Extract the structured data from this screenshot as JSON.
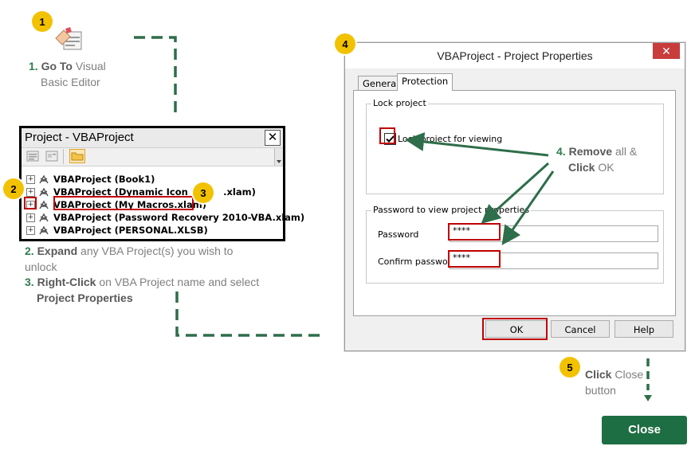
{
  "steps": {
    "s1": {
      "badge": "1",
      "num": "1.",
      "bold": "Go To",
      "rest1": "Visual",
      "rest2": "Basic Editor"
    },
    "s2": {
      "badge": "2",
      "num": "2.",
      "bold": "Expand",
      "rest": "any VBA Project(s) you wish to",
      "rest2": "unlock"
    },
    "s3": {
      "badge": "3",
      "num": "3.",
      "bold": "Right-Click",
      "rest": "on VBA Project name and select",
      "bold2": "Project Properties"
    },
    "s4": {
      "badge": "4",
      "num": "4.",
      "bold": "Remove",
      "rest": "all &",
      "bold2": "Click",
      "rest2": "OK"
    },
    "s5": {
      "badge": "5",
      "bold": "Click",
      "rest": "Close",
      "rest2": "button"
    }
  },
  "project_window": {
    "title": "Project - VBAProject",
    "close_glyph": "✕",
    "items": [
      {
        "label": "VBAProject (Book1)"
      },
      {
        "label": "VBAProject (Dynamic Icon Bro",
        "label_tail": ".xlam)"
      },
      {
        "label": "VBAProject (My Macros.xlam)"
      },
      {
        "label": "VBAProject (Password Recovery 2010-VBA.xlam)"
      },
      {
        "label": "VBAProject (PERSONAL.XLSB)"
      }
    ],
    "expand_glyph": "+"
  },
  "dialog": {
    "title": "VBAProject - Project Properties",
    "close_glyph": "✕",
    "tabs": [
      "General",
      "Protection"
    ],
    "lock_group_label": "Lock project",
    "lock_checkbox_label": "Lock project for viewing",
    "lock_checked": true,
    "password_group_label": "Password to view project properties",
    "password_label": "Password",
    "password_value": "****",
    "confirm_label": "Confirm password",
    "confirm_value": "****",
    "buttons": {
      "ok": "OK",
      "cancel": "Cancel",
      "help": "Help"
    }
  },
  "close_button": "Close",
  "colors": {
    "accent_green": "#1e6e43",
    "badge_yellow": "#f2c200",
    "highlight_red": "#c00000",
    "dash_green": "#2e6e4a"
  }
}
